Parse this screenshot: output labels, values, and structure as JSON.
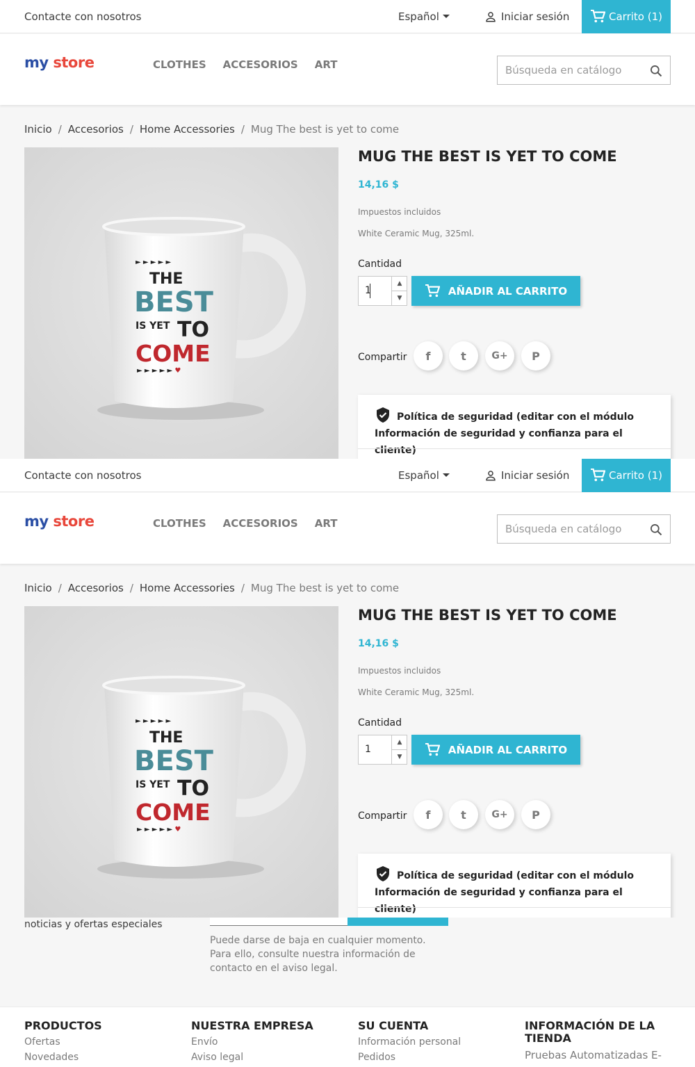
{
  "topbar": {
    "contact": "Contacte con nosotros",
    "language": "Español",
    "signin": "Iniciar sesión",
    "cart": "Carrito (1)"
  },
  "header": {
    "logo_my": "my",
    "logo_store": "store",
    "nav": [
      "CLOTHES",
      "ACCESORIOS",
      "ART"
    ],
    "search_placeholder": "Búsqueda en catálogo"
  },
  "breadcrumb": [
    "Inicio",
    "Accesorios",
    "Home Accessories",
    "Mug The best is yet to come"
  ],
  "product": {
    "title": "MUG THE BEST IS YET TO COME",
    "price": "14,16 $",
    "tax": "Impuestos incluidos",
    "description": "White Ceramic Mug, 325ml.",
    "quantity_label": "Cantidad",
    "quantity_value": "1",
    "add_to_cart": "AÑADIR AL CARRITO",
    "share_label": "Compartir",
    "social": [
      "f",
      "t",
      "G+",
      "P"
    ],
    "mug_lines": [
      "THE",
      "BEST",
      "IS YET",
      "TO",
      "COME"
    ]
  },
  "reassurance": {
    "text": "Política de seguridad (editar con el módulo Información de seguridad y confianza para el cliente)"
  },
  "newsletter": {
    "left_text": "noticias y ofertas especiales",
    "note": "Puede darse de baja en cualquier momento. Para ello, consulte nuestra información de contacto en el aviso legal."
  },
  "footer": {
    "col1": {
      "title": "PRODUCTOS",
      "items": [
        "Ofertas",
        "Novedades"
      ]
    },
    "col2": {
      "title": "NUESTRA EMPRESA",
      "items": [
        "Envío",
        "Aviso legal"
      ]
    },
    "col3": {
      "title": "SU CUENTA",
      "items": [
        "Información personal",
        "Pedidos"
      ]
    },
    "col4": {
      "title": "INFORMACIÓN DE LA TIENDA",
      "items": [
        "Pruebas Automatizadas E-"
      ]
    }
  },
  "colors": {
    "accent": "#2fb5d2",
    "text": "#232323",
    "muted": "#7a7a7a"
  }
}
